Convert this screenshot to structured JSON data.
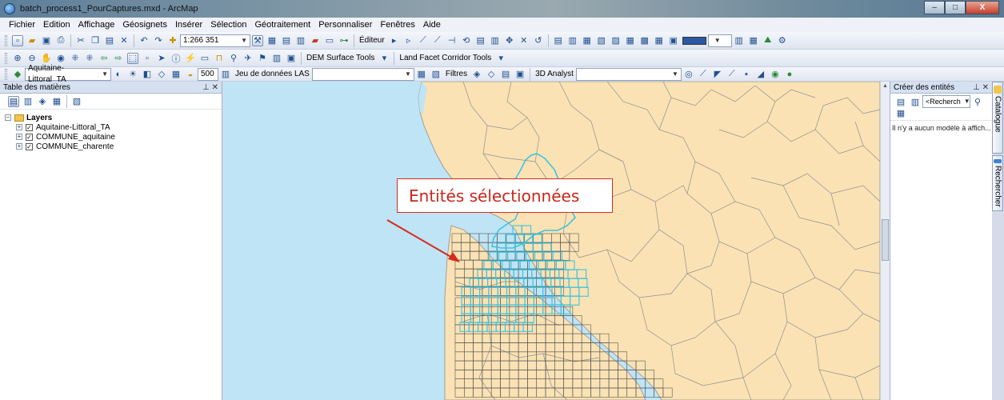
{
  "window": {
    "title": "batch_process1_PourCaptures.mxd - ArcMap",
    "minimize": "–",
    "maximize": "□",
    "close": "X"
  },
  "menu": [
    "Fichier",
    "Edition",
    "Affichage",
    "Géosignets",
    "Insérer",
    "Sélection",
    "Géotraitement",
    "Personnaliser",
    "Fenêtres",
    "Aide"
  ],
  "toolbar1": {
    "scale": "1:266 351",
    "editor": "Éditeur"
  },
  "toolbar2": {
    "dem_tools": "DEM Surface Tools",
    "land_facet": "Land Facet Corridor Tools"
  },
  "toolbar3": {
    "layer_select": "Aquitaine-Littoral_TA",
    "resolution": "500",
    "las_label": "Jeu de données LAS",
    "filters": "Filtres",
    "analyst_3d": "3D Analyst"
  },
  "toc": {
    "title": "Table des matières",
    "root": "Layers",
    "layers": [
      "Aquitaine-Littoral_TA",
      "COMMUNE_aquitaine",
      "COMMUNE_charente"
    ]
  },
  "map": {
    "callout": "Entités sélectionnées",
    "colors": {
      "sea": "#bfe4f6",
      "land": "#fae2b4",
      "boundary": "#8f8f8f",
      "grid": "#555555",
      "selection": "#3ec4dd",
      "arrow": "#d62a1e"
    }
  },
  "right_panel": {
    "title": "Créer des entités",
    "search_placeholder": "<Recherch",
    "empty_message": "Il n'y a aucun modèle à affich..."
  },
  "side_tabs": [
    "Catalogue",
    "Rechercher"
  ]
}
